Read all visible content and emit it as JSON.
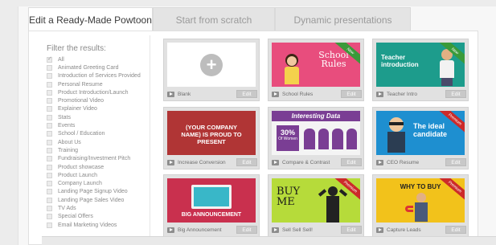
{
  "tabs": [
    {
      "label": "Edit a Ready-Made Powtoon"
    },
    {
      "label": "Start from scratch"
    },
    {
      "label": "Dynamic presentations"
    }
  ],
  "filters": {
    "title": "Filter the results:",
    "items": [
      {
        "label": "All",
        "checked": true
      },
      {
        "label": "Animated Greeting Card"
      },
      {
        "label": "Introduction of Services Provided"
      },
      {
        "label": "Personal Resume"
      },
      {
        "label": "Product Introduction/Launch"
      },
      {
        "label": "Promotional Video"
      },
      {
        "label": "Explainer Video"
      },
      {
        "label": "Stats"
      },
      {
        "label": "Events"
      },
      {
        "label": "School / Education"
      },
      {
        "label": "About Us"
      },
      {
        "label": "Training"
      },
      {
        "label": "Fundraising/Investment Pitch"
      },
      {
        "label": "Product showcase"
      },
      {
        "label": "Product Launch"
      },
      {
        "label": "Company Launch"
      },
      {
        "label": "Landing Page Signup Video"
      },
      {
        "label": "Landing Page Sales Video"
      },
      {
        "label": "TV Ads"
      },
      {
        "label": "Special Offers"
      },
      {
        "label": "Email Marketing Videos"
      }
    ]
  },
  "templates": [
    {
      "label": "Blank",
      "edit": "Edit",
      "thumb_text": ""
    },
    {
      "label": "School Rules",
      "edit": "Edit",
      "thumb_text": "School Rules",
      "ribbon": "New"
    },
    {
      "label": "Teacher Intro",
      "edit": "Edit",
      "thumb_text": "Teacher introduction",
      "ribbon": "New"
    },
    {
      "label": "Increase Conversion",
      "edit": "Edit",
      "thumb_text": "(YOUR COMPANY NAME) IS PROUD TO PRESENT"
    },
    {
      "label": "Compare & Contrast",
      "edit": "Edit",
      "thumb_text": "Interesting Data",
      "stat": "30%",
      "stat_sub": "Of Women"
    },
    {
      "label": "CEO Resume",
      "edit": "Edit",
      "thumb_text": "The ideal candidate",
      "ribbon": "Premium"
    },
    {
      "label": "Big Announcement",
      "edit": "Edit",
      "thumb_text": "BIG ANNOUNCEMENT"
    },
    {
      "label": "Sell Sell Sell!",
      "edit": "Edit",
      "thumb_text": "BUY ME",
      "ribbon": "Premium"
    },
    {
      "label": "Capture Leads",
      "edit": "Edit",
      "thumb_text": "WHY TO BUY",
      "ribbon": "Premium"
    }
  ],
  "colors": {
    "school_bg": "#e84d7d",
    "teacher_bg": "#1d9c8c",
    "conversion_bg": "#c83a3a",
    "data_bg": "#7a3e94",
    "ceo_bg": "#1e8fd0",
    "announce_bg": "#c9304e",
    "buy_bg": "#b6db3a",
    "leads_bg": "#f2c21b"
  }
}
